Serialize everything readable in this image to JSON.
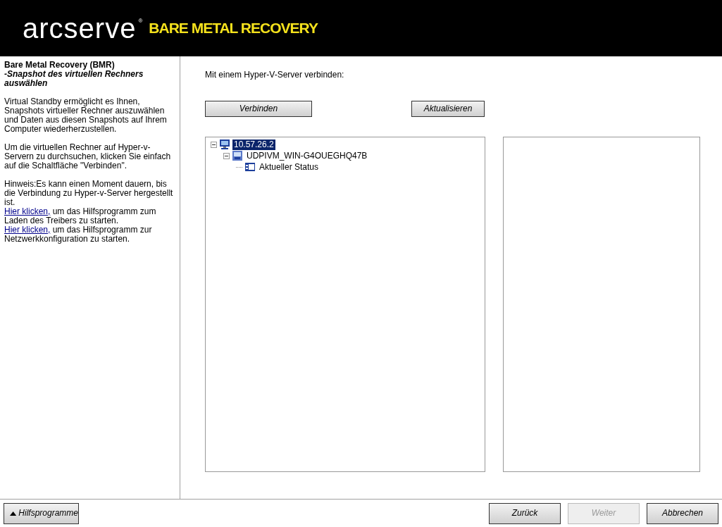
{
  "header": {
    "brand": "arcserve",
    "registered": "®",
    "product": "BARE METAL RECOVERY"
  },
  "sidebar": {
    "title": "Bare Metal Recovery (BMR)",
    "subtitle": "-Snapshot des virtuellen Rechners auswählen",
    "paragraphs": [
      "Virtual Standby ermöglicht es Ihnen, Snapshots virtueller Rechner auszuwählen und Daten aus diesen Snapshots auf Ihrem Computer wiederherzustellen.",
      "Um die virtuellen Rechner auf Hyper-v-Servern zu durchsuchen, klicken Sie einfach auf die Schaltfläche \"Verbinden\"."
    ],
    "note": "Hinweis:Es kann einen Moment dauern, bis die Verbindung zu Hyper-v-Server hergestellt ist.",
    "link_lines": [
      {
        "link": "Hier klicken,",
        "text": "um das Hilfsprogramm zum Laden des Treibers zu starten."
      },
      {
        "link": "Hier klicken,",
        "text": "um das Hilfsprogramm zur Netzwerkkonfiguration zu starten."
      }
    ]
  },
  "main": {
    "prompt": "Mit einem Hyper-V-Server verbinden:",
    "buttons": [
      {
        "label": "Verbinden"
      },
      {
        "label": "Aktualisieren"
      }
    ],
    "tree": [
      {
        "label": "10.57.26.2",
        "kind": "server",
        "expanded": true,
        "selected": true,
        "children": [
          {
            "label": "UDPIVM_WIN-G4OUEGHQ47B",
            "kind": "vm",
            "expanded": true,
            "selected": false,
            "children": [
              {
                "label": "Aktueller Status",
                "kind": "snapshot",
                "selected": false
              }
            ]
          }
        ]
      }
    ]
  },
  "footer": {
    "utilities": "Hilfsprogramme",
    "buttons": [
      {
        "label": "Zurück",
        "disabled": false
      },
      {
        "label": "Weiter",
        "disabled": true
      },
      {
        "label": "Abbrechen",
        "disabled": false
      }
    ]
  }
}
